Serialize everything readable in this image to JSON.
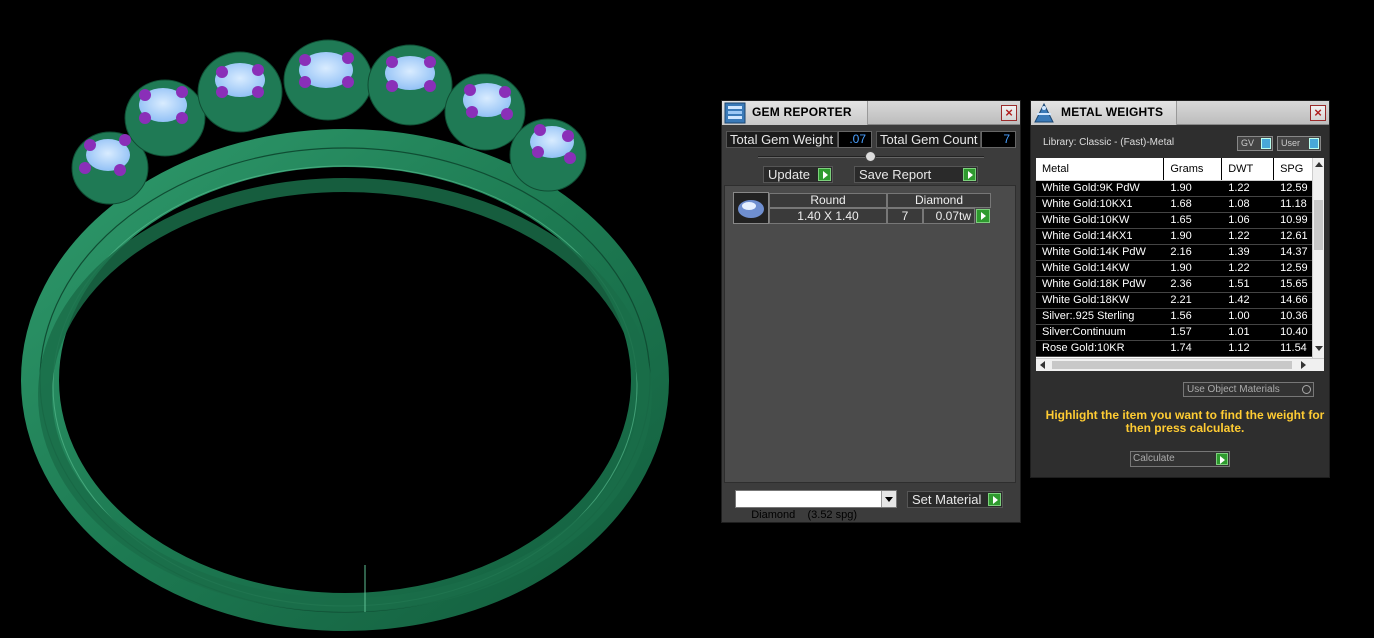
{
  "gem_reporter": {
    "title": "GEM REPORTER",
    "total_weight_label": "Total Gem Weight",
    "total_weight_value": ".07",
    "total_count_label": "Total Gem Count",
    "total_count_value": "7",
    "update_label": "Update",
    "save_report_label": "Save Report",
    "gem_row": {
      "shape": "Round",
      "type": "Diamond",
      "size": "1.40 X 1.40",
      "count": "7",
      "weight": "0.07tw"
    },
    "material_select": "Diamond    (3.52 spg)",
    "set_material_label": "Set Material"
  },
  "metal_weights": {
    "title": "METAL WEIGHTS",
    "library_label": "Library: Classic - (Fast)-Metal",
    "gv_label": "GV",
    "user_label": "User",
    "columns": [
      "Metal",
      "Grams",
      "DWT",
      "SPG"
    ],
    "rows": [
      [
        "White Gold:9K PdW",
        "1.90",
        "1.22",
        "12.59"
      ],
      [
        "White Gold:10KX1",
        "1.68",
        "1.08",
        "11.18"
      ],
      [
        "White Gold:10KW",
        "1.65",
        "1.06",
        "10.99"
      ],
      [
        "White Gold:14KX1",
        "1.90",
        "1.22",
        "12.61"
      ],
      [
        "White Gold:14K PdW",
        "2.16",
        "1.39",
        "14.37"
      ],
      [
        "White Gold:14KW",
        "1.90",
        "1.22",
        "12.59"
      ],
      [
        "White Gold:18K PdW",
        "2.36",
        "1.51",
        "15.65"
      ],
      [
        "White Gold:18KW",
        "2.21",
        "1.42",
        "14.66"
      ],
      [
        "Silver:.925 Sterling",
        "1.56",
        "1.00",
        "10.36"
      ],
      [
        "Silver:Continuum",
        "1.57",
        "1.01",
        "10.40"
      ],
      [
        "Rose Gold:10KR",
        "1.74",
        "1.12",
        "11.54"
      ]
    ],
    "use_object_materials": "Use Object Materials",
    "hint": "Highlight the item you want to find the weight for then press calculate.",
    "calculate_label": "Calculate"
  },
  "colors": {
    "ring": "#1f7a55",
    "gem": "#a9d2ff",
    "prong": "#8a2fb8",
    "hint_text": "#ffcc33"
  },
  "icons": {
    "gem_reporter": "gem-report-icon",
    "metal_weights": "metal-weights-icon"
  }
}
